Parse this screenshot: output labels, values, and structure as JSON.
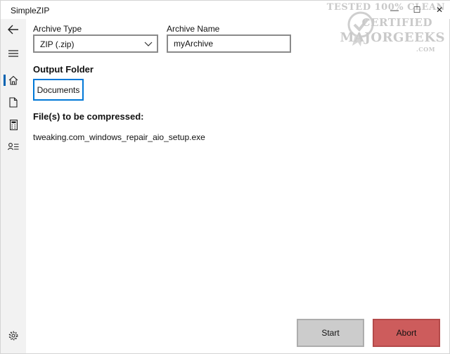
{
  "app": {
    "title": "SimpleZIP"
  },
  "window_controls": {
    "minimize": "—",
    "maximize": "☐",
    "close": "✕"
  },
  "watermark": {
    "line1": "TESTED 100% CLEAN",
    "line2": "CERTIFIED",
    "line3": "MAJORGEEKS",
    "line4": ".COM"
  },
  "sidebar": {
    "items": [
      {
        "icon": "back-arrow-icon"
      },
      {
        "icon": "hamburger-menu-icon"
      },
      {
        "icon": "home-icon",
        "selected": true
      },
      {
        "icon": "document-icon"
      },
      {
        "icon": "calculator-icon"
      },
      {
        "icon": "contact-list-icon"
      }
    ],
    "footer": {
      "icon": "gear-icon"
    }
  },
  "archive_type": {
    "label": "Archive Type",
    "value": "ZIP (.zip)"
  },
  "archive_name": {
    "label": "Archive Name",
    "value": "myArchive"
  },
  "output_folder": {
    "label": "Output Folder",
    "button": "Documents"
  },
  "files": {
    "label": "File(s) to be compressed:",
    "items": [
      "tweaking.com_windows_repair_aio_setup.exe"
    ]
  },
  "actions": {
    "start": "Start",
    "abort": "Abort"
  },
  "colors": {
    "accent": "#0078d7",
    "abort": "#cd5c5c",
    "start": "#cccccc",
    "sidebar": "#f2f2f2"
  }
}
